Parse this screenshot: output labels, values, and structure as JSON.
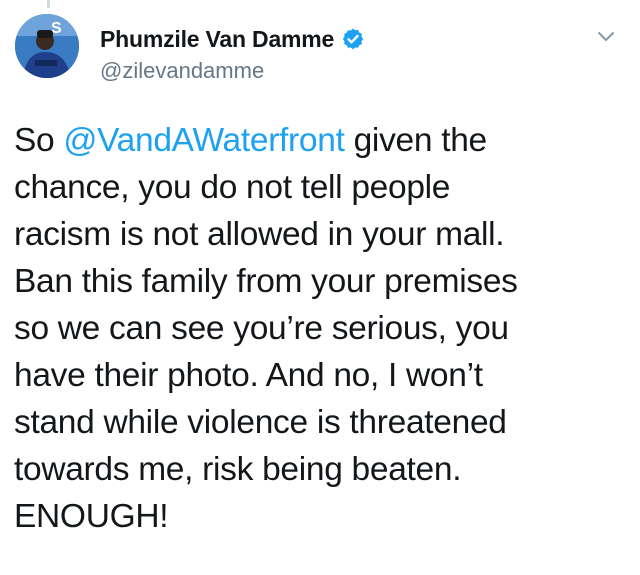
{
  "author": {
    "display_name": "Phumzile Van Damme",
    "handle": "@zilevandamme",
    "verified": true
  },
  "tweet": {
    "lines": [
      {
        "before": "So ",
        "mention": "@VandAWaterfront",
        "after": " given the"
      },
      {
        "text": "chance, you do not tell people"
      },
      {
        "text": "racism is not allowed in your mall."
      },
      {
        "text": "Ban this family from your premises"
      },
      {
        "text": "so we can see you’re serious, you"
      },
      {
        "text": "have their photo. And no, I won’t"
      },
      {
        "text": "stand while violence is threatened"
      },
      {
        "text": "towards me, risk being beaten."
      },
      {
        "text": "ENOUGH!"
      }
    ]
  },
  "icons": {
    "verified": "verified-badge-icon",
    "menu": "chevron-down-icon"
  },
  "colors": {
    "link": "#1da1f2",
    "verified_badge": "#1da1f2",
    "secondary_text": "#657786",
    "primary_text": "#14171a"
  }
}
